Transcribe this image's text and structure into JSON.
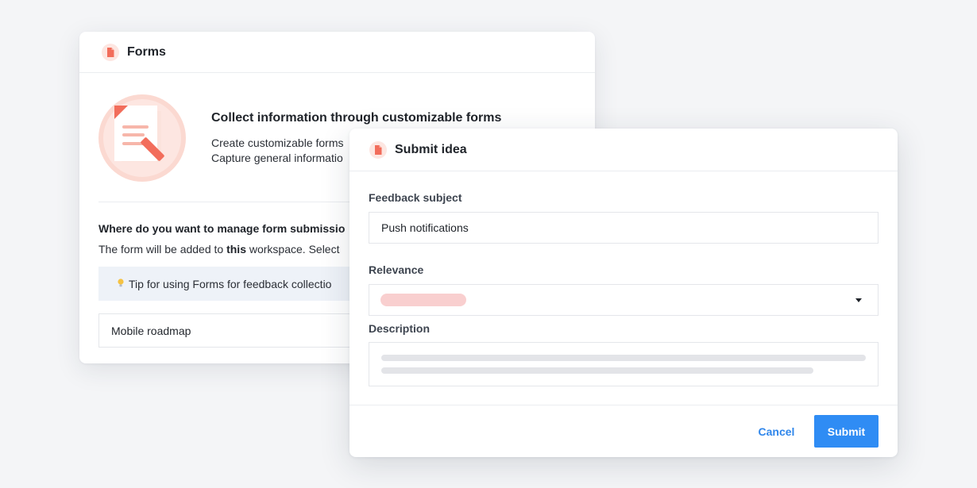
{
  "forms_card": {
    "title": "Forms",
    "icon": "document-icon",
    "hero": {
      "title": "Collect information through customizable forms",
      "line1": "Create customizable forms",
      "line2": "Capture general informatio"
    },
    "manage": {
      "question": "Where do you want to manage form submissio",
      "desc_prefix": "The form will be added to ",
      "desc_bold": "this",
      "desc_suffix": " workspace. Select"
    },
    "tip": {
      "icon": "lightbulb-icon",
      "text": "Tip for using Forms for feedback collectio"
    },
    "workspace_value": "Mobile roadmap"
  },
  "submit_dialog": {
    "title": "Submit idea",
    "icon": "document-icon",
    "fields": {
      "subject_label": "Feedback subject",
      "subject_value": "Push notifications",
      "relevance_label": "Relevance",
      "relevance_color": "#f9cfcf",
      "description_label": "Description"
    },
    "buttons": {
      "cancel": "Cancel",
      "submit": "Submit"
    }
  },
  "colors": {
    "accent": "#2f8cf4",
    "link": "#2f86eb",
    "brand_icon": "#f26d5b",
    "tip_background": "#eef2f8"
  }
}
